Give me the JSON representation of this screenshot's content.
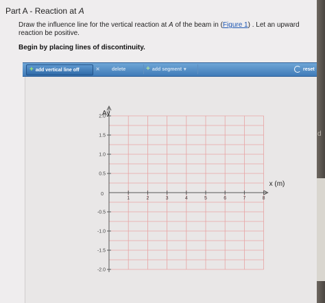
{
  "part": {
    "prefix": "Part A",
    "separator": " - ",
    "title_text": "Reaction at ",
    "title_var": "A"
  },
  "instructions": {
    "text1": "Draw the influence line for the vertical reaction at ",
    "var": "A",
    "text2": " of the beam in (",
    "link": "Figure 1",
    "text3": ") . Let an upward reaction be positive."
  },
  "begin_text": "Begin by placing lines of discontinuity.",
  "toolbar": {
    "add_vertical_label": "add vertical line off",
    "delete_x": "✕",
    "delete_label": "delete",
    "add_segment_label": "add segment",
    "reset_label": "reset",
    "bar_color": "#4a86c3"
  },
  "graph": {
    "y_axis_label": "Ay",
    "x_axis_label": "x (m)",
    "origin_label": "0",
    "x_ticks": [
      "1",
      "2",
      "3",
      "4",
      "5",
      "6",
      "7",
      "8"
    ],
    "y_ticks": [
      "2.0",
      "1.5",
      "1.0",
      "0.5",
      "-0.5",
      "-1.0",
      "-1.5",
      "-2.0"
    ],
    "grid_color": "#e8a3a3"
  },
  "edge": {
    "letter": "d"
  }
}
